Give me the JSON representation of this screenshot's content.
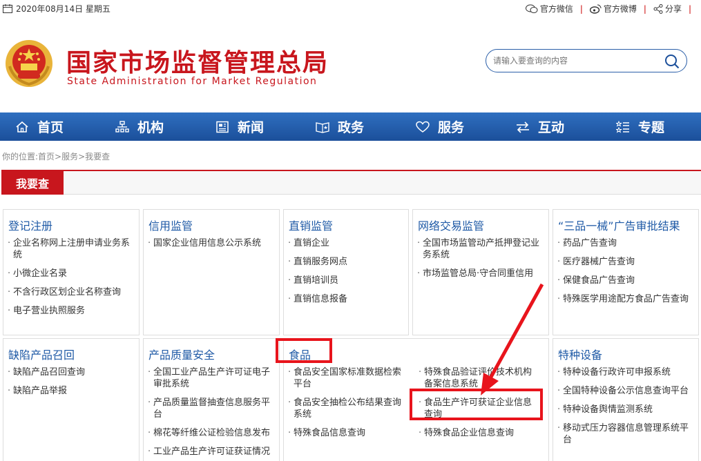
{
  "topbar": {
    "date": "2020年08月14日 星期五",
    "wechat": "官方微信",
    "weibo": "官方微博",
    "share": "分享"
  },
  "header": {
    "title": "国家市场监督管理总局",
    "subtitle": "State Administration for Market Regulation",
    "search_placeholder": "请输入要查询的内容"
  },
  "nav": [
    "首页",
    "机构",
    "新闻",
    "政务",
    "服务",
    "互动",
    "专题"
  ],
  "breadcrumb": "你的位置:首页>服务>我要查",
  "section": {
    "tab": "我要查"
  },
  "cards": {
    "c1": {
      "title": "登记注册",
      "items": [
        "企业名称网上注册申请业务系统",
        "小微企业名录",
        "不含行政区划企业名称查询",
        "电子营业执照服务"
      ]
    },
    "c2": {
      "title": "信用监管",
      "items": [
        "国家企业信用信息公示系统"
      ]
    },
    "c3": {
      "title": "直销监管",
      "items": [
        "直销企业",
        "直销服务网点",
        "直销培训员",
        "直销信息报备"
      ]
    },
    "c4": {
      "title": "网络交易监管",
      "items": [
        "全国市场监管动产抵押登记业务系统",
        "市场监管总局·守合同重信用"
      ]
    },
    "c5": {
      "title": "“三品一械”广告审批结果",
      "items": [
        "药品广告查询",
        "医疗器械广告查询",
        "保健食品广告查询",
        "特殊医学用途配方食品广告查询"
      ]
    },
    "c6": {
      "title": "缺陷产品召回",
      "items": [
        "缺陷产品召回查询",
        "缺陷产品举报"
      ]
    },
    "c7": {
      "title": "产品质量安全",
      "items": [
        "全国工业产品生产许可证电子审批系统",
        "产品质量监督抽查信息服务平台",
        "棉花等纤维公证检验信息发布",
        "工业产品生产许可证获证情况"
      ]
    },
    "c8": {
      "title": "食品",
      "items_left": [
        "食品安全国家标准数据检索平台",
        "食品安全抽检公布结果查询系统",
        "特殊食品信息查询"
      ],
      "items_right": [
        "特殊食品验证评价技术机构备案信息系统",
        "食品生产许可获证企业信息查询",
        "特殊食品企业信息查询"
      ]
    },
    "c9": {
      "title": "特种设备",
      "items": [
        "特种设备行政许可申报系统",
        "全国特种设备公示信息查询平台",
        "特种设备舆情监测系统",
        "移动式压力容器信息管理系统平台"
      ]
    }
  },
  "colors": {
    "brand_red": "#c8161d",
    "nav_blue": "#1b4f9a",
    "link_blue": "#1f5aa6",
    "annotation_red": "#e8141c"
  }
}
